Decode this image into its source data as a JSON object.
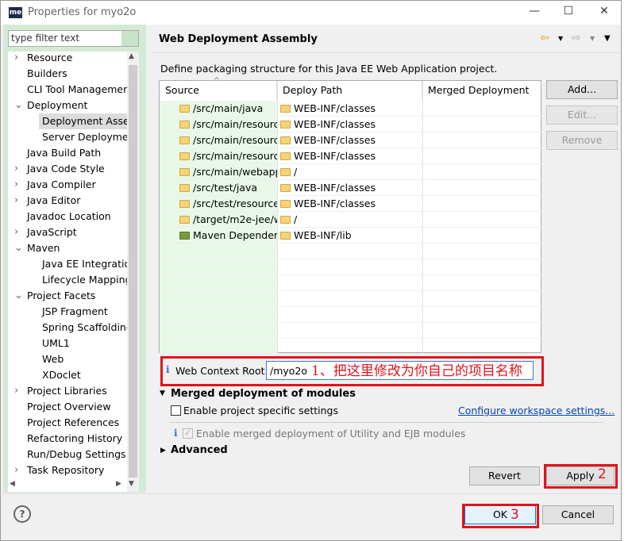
{
  "window": {
    "title": "Properties for myo2o",
    "logo": "me",
    "controls": [
      "minimize",
      "maximize",
      "close"
    ]
  },
  "filter": {
    "placeholder": "type filter text"
  },
  "tree": [
    {
      "label": "Resource",
      "level": 0,
      "twisty": "collapsed"
    },
    {
      "label": "Builders",
      "level": 0,
      "twisty": "none"
    },
    {
      "label": "CLI Tool Managemen",
      "level": 0,
      "twisty": "none"
    },
    {
      "label": "Deployment",
      "level": 0,
      "twisty": "expanded"
    },
    {
      "label": "Deployment Asser",
      "level": 1,
      "twisty": "none",
      "selected": true
    },
    {
      "label": "Server Deploymen",
      "level": 1,
      "twisty": "none"
    },
    {
      "label": "Java Build Path",
      "level": 0,
      "twisty": "none"
    },
    {
      "label": "Java Code Style",
      "level": 0,
      "twisty": "collapsed"
    },
    {
      "label": "Java Compiler",
      "level": 0,
      "twisty": "collapsed"
    },
    {
      "label": "Java Editor",
      "level": 0,
      "twisty": "collapsed"
    },
    {
      "label": "Javadoc Location",
      "level": 0,
      "twisty": "none"
    },
    {
      "label": "JavaScript",
      "level": 0,
      "twisty": "collapsed"
    },
    {
      "label": "Maven",
      "level": 0,
      "twisty": "expanded"
    },
    {
      "label": "Java EE Integratio",
      "level": 1,
      "twisty": "none"
    },
    {
      "label": "Lifecycle Mapping",
      "level": 1,
      "twisty": "none"
    },
    {
      "label": "Project Facets",
      "level": 0,
      "twisty": "expanded"
    },
    {
      "label": "JSP Fragment",
      "level": 1,
      "twisty": "none"
    },
    {
      "label": "Spring Scaffolding",
      "level": 1,
      "twisty": "none"
    },
    {
      "label": "UML1",
      "level": 1,
      "twisty": "none"
    },
    {
      "label": "Web",
      "level": 1,
      "twisty": "none"
    },
    {
      "label": "XDoclet",
      "level": 1,
      "twisty": "none"
    },
    {
      "label": "Project Libraries",
      "level": 0,
      "twisty": "collapsed"
    },
    {
      "label": "Project Overview",
      "level": 0,
      "twisty": "none"
    },
    {
      "label": "Project References",
      "level": 0,
      "twisty": "none"
    },
    {
      "label": "Refactoring History",
      "level": 0,
      "twisty": "none"
    },
    {
      "label": "Run/Debug Settings",
      "level": 0,
      "twisty": "none"
    },
    {
      "label": "Task Repository",
      "level": 0,
      "twisty": "collapsed"
    }
  ],
  "page": {
    "title": "Web Deployment Assembly",
    "description": "Define packaging structure for this Java EE Web Application project.",
    "nav_icons": [
      "back-arrow",
      "dropdown",
      "forward-arrow",
      "dropdown",
      "menu"
    ]
  },
  "table": {
    "columns": [
      "Source",
      "Deploy Path",
      "Merged Deployment"
    ],
    "rows": [
      {
        "source": "/src/main/java",
        "deploy": "WEB-INF/classes",
        "merged": ""
      },
      {
        "source": "/src/main/resourc",
        "deploy": "WEB-INF/classes",
        "merged": ""
      },
      {
        "source": "/src/main/resourc",
        "deploy": "WEB-INF/classes",
        "merged": ""
      },
      {
        "source": "/src/main/resourc",
        "deploy": "WEB-INF/classes",
        "merged": ""
      },
      {
        "source": "/src/main/webapp",
        "deploy": "/",
        "merged": ""
      },
      {
        "source": "/src/test/java",
        "deploy": "WEB-INF/classes",
        "merged": ""
      },
      {
        "source": "/src/test/resource",
        "deploy": "WEB-INF/classes",
        "merged": ""
      },
      {
        "source": "/target/m2e-jee/w",
        "deploy": "/",
        "merged": ""
      },
      {
        "source": "Maven Dependen",
        "deploy": "WEB-INF/lib",
        "merged": "",
        "icon": "library"
      }
    ]
  },
  "buttons": {
    "add": "Add...",
    "edit": "Edit...",
    "remove": "Remove",
    "revert": "Revert",
    "apply": "Apply",
    "ok": "OK",
    "cancel": "Cancel"
  },
  "context_root": {
    "label": "Web Context Root:",
    "value": "/myo2o"
  },
  "merged": {
    "title": "Merged deployment of modules",
    "enable_specific": "Enable project specific settings",
    "enable_specific_checked": false,
    "configure_link": "Configure workspace settings...",
    "enable_merged": "Enable merged deployment of Utility and EJB modules",
    "enable_merged_checked": true
  },
  "advanced": "Advanced",
  "annotations": {
    "step1": "1、把这里修改为你自己的项目名称",
    "step2": "2",
    "step3": "3",
    "color": "#e0141b"
  }
}
